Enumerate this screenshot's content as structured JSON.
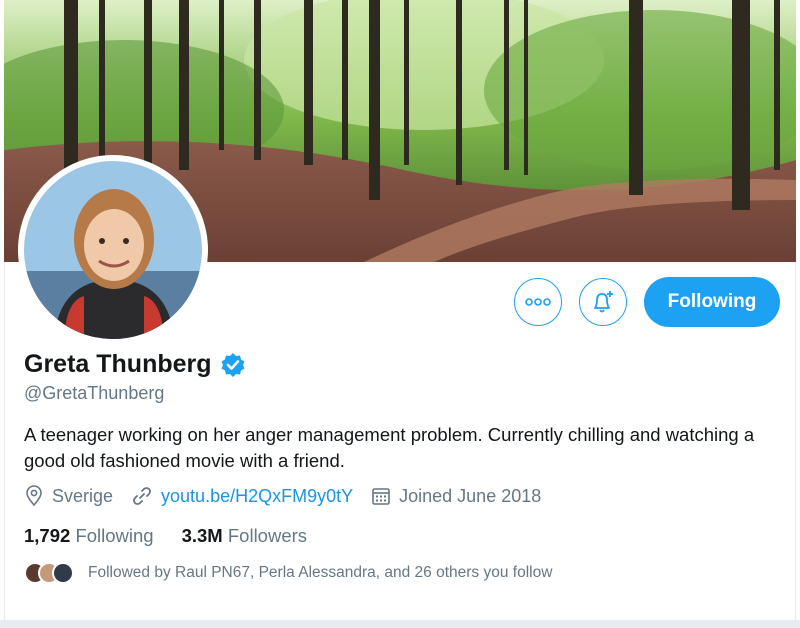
{
  "profile": {
    "name": "Greta Thunberg",
    "handle": "@GretaThunberg",
    "bio": "A teenager working on her anger management problem. Currently chilling and watching a good old fashioned movie with a friend.",
    "location": "Sverige",
    "link": "youtu.be/H2QxFM9y0tY",
    "joined": "Joined June 2018",
    "following_count": "1,792",
    "following_label": "Following",
    "followers_count": "3.3M",
    "followers_label": "Followers",
    "followed_by": "Followed by Raul PN67, Perla Alessandra, and 26 others you follow"
  },
  "actions": {
    "more_icon": "more-dots-icon",
    "notify_icon": "bell-plus-icon",
    "follow_label": "Following"
  },
  "colors": {
    "accent": "#1da1f2",
    "link": "#1b95e0",
    "muted": "#657786",
    "text": "#14171a"
  }
}
